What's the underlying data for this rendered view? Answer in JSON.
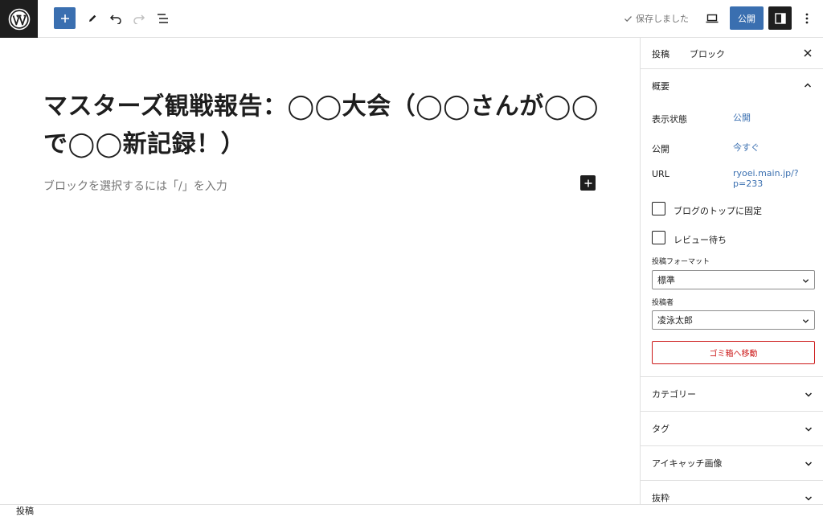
{
  "toolbar": {
    "saved_label": "保存しました",
    "publish_label": "公開"
  },
  "editor": {
    "title": "マスターズ観戦報告：◯◯大会（◯◯さんが◯◯で◯◯新記録！）",
    "block_placeholder": "ブロックを選択するには「/」を入力"
  },
  "sidebar": {
    "tabs": [
      "投稿",
      "ブロック"
    ],
    "summary": {
      "title": "概要",
      "visibility_label": "表示状態",
      "visibility_value": "公開",
      "publish_label": "公開",
      "publish_value": "今すぐ",
      "url_label": "URL",
      "url_value_1": "ryoei.main.jp/?",
      "url_value_2": "p=233",
      "sticky_label": "ブログのトップに固定",
      "pending_label": "レビュー待ち",
      "format_label": "投稿フォーマット",
      "format_value": "標準",
      "author_label": "投稿者",
      "author_value": "凌泳太郎",
      "trash_label": "ゴミ箱へ移動"
    },
    "accordions": [
      "カテゴリー",
      "タグ",
      "アイキャッチ画像",
      "抜粋"
    ]
  },
  "footer": {
    "breadcrumb": "投稿"
  },
  "colors": {
    "accent": "#3a6fb0",
    "danger": "#cc1818",
    "dark": "#1e1e1e",
    "muted": "#757575"
  }
}
